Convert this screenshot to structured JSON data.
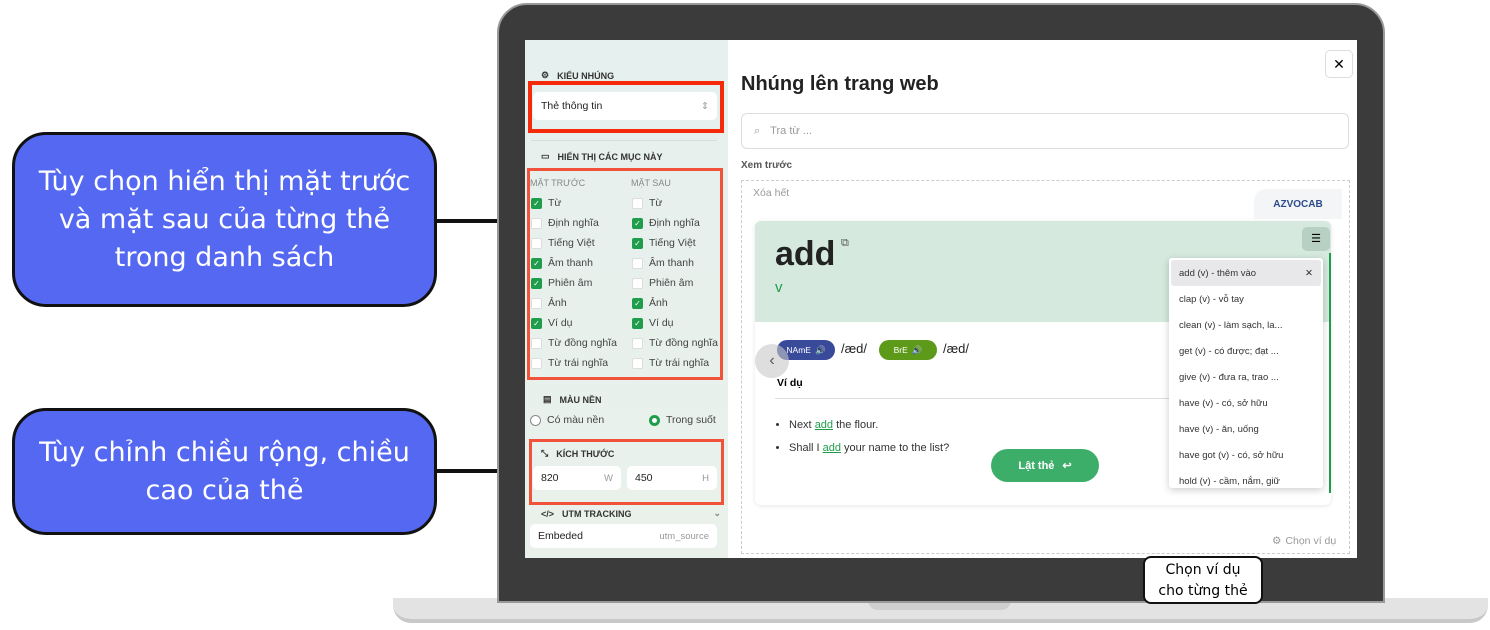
{
  "callouts": {
    "display_options": "Tùy chọn hiển thị mặt trước và mặt sau của từng thẻ trong danh sách",
    "size": "Tùy chỉnh chiều rộng, chiều cao của thẻ",
    "example": "Chọn ví dụ cho từng thẻ"
  },
  "sidebar": {
    "embed_type_label": "KIỂU NHÚNG",
    "embed_type_value": "Thẻ thông tin",
    "display_label": "HIỂN THỊ CÁC MỤC NÀY",
    "front_label": "MẶT TRƯỚC",
    "back_label": "MẶT SAU",
    "front": [
      {
        "label": "Từ",
        "checked": true
      },
      {
        "label": "Định nghĩa",
        "checked": false
      },
      {
        "label": "Tiếng Việt",
        "checked": false
      },
      {
        "label": "Âm thanh",
        "checked": true
      },
      {
        "label": "Phiên âm",
        "checked": true
      },
      {
        "label": "Ảnh",
        "checked": false
      },
      {
        "label": "Ví dụ",
        "checked": true
      },
      {
        "label": "Từ đồng nghĩa",
        "checked": false
      },
      {
        "label": "Từ trái nghĩa",
        "checked": false
      }
    ],
    "back": [
      {
        "label": "Từ",
        "checked": false
      },
      {
        "label": "Định nghĩa",
        "checked": true
      },
      {
        "label": "Tiếng Việt",
        "checked": true
      },
      {
        "label": "Âm thanh",
        "checked": false
      },
      {
        "label": "Phiên âm",
        "checked": false
      },
      {
        "label": "Ảnh",
        "checked": true
      },
      {
        "label": "Ví dụ",
        "checked": true
      },
      {
        "label": "Từ đồng nghĩa",
        "checked": false
      },
      {
        "label": "Từ trái nghĩa",
        "checked": false
      }
    ],
    "bg_label": "MÀU NỀN",
    "bg_options": [
      "Có màu nền",
      "Trong suốt"
    ],
    "bg_selected": "Trong suốt",
    "size_label": "KÍCH THƯỚC",
    "width": "820",
    "width_unit": "W",
    "height": "450",
    "height_unit": "H",
    "utm_label": "UTM TRACKING",
    "utm_value": "Embeded",
    "utm_key": "utm_source"
  },
  "main": {
    "title": "Nhúng lên trang web",
    "search_placeholder": "Tra từ ...",
    "preview_label": "Xem trước",
    "clear_all": "Xóa hết",
    "logo": "AZVOCAB",
    "card": {
      "word": "add",
      "pos": "v",
      "name_label": "NAmE",
      "name_ipa": "/æd/",
      "bre_label": "BrE",
      "bre_ipa": "/æd/",
      "example_heading": "Ví dụ",
      "examples": [
        [
          "Next ",
          "add",
          " the flour."
        ],
        [
          "Shall I ",
          "add",
          " your name to the list?"
        ]
      ],
      "flip_button": "Lật thẻ"
    },
    "word_list": [
      "add (v) - thêm vào",
      "clap (v) - vỗ tay",
      "clean (v) - làm sạch, la...",
      "get (v) - có được; đạt ...",
      "give (v) - đưa ra, trao ...",
      "have (v) - có, sở hữu",
      "have (v) - ăn, uống",
      "have got (v) - có, sở hữu",
      "hold (v) - cầm, nắm, giữ"
    ],
    "choose_example": "Chọn ví dụ"
  },
  "colors": {
    "accent": "#1f9d4c",
    "callout": "#5468f2",
    "highlight": "#f0523a",
    "name_badge": "#3a4a9a",
    "bre_badge": "#5e9a1a"
  }
}
